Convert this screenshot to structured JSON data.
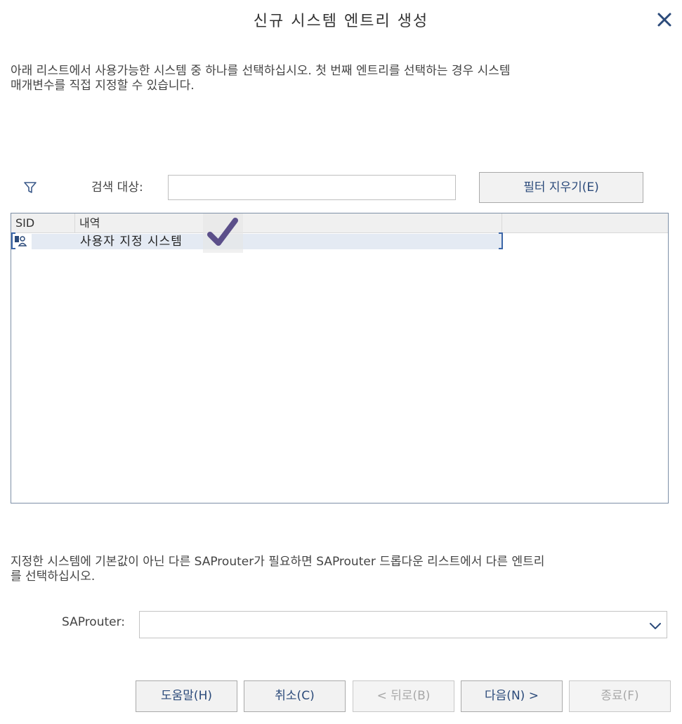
{
  "dialog": {
    "title": "신규 시스템 엔트리 생성",
    "close_icon": "close-icon"
  },
  "intro_text": {
    "line1": "아래 리스트에서 사용가능한 시스템 중 하나를 선택하십시오. 첫 번째 엔트리를 선택하는 경우 시스템",
    "line2": "매개변수를 직접 지정할 수 있습니다."
  },
  "filter": {
    "icon": "filter-icon",
    "search_label": "검색 대상:",
    "search_value": "",
    "clear_button": "필터 지우기(E)"
  },
  "system_list": {
    "columns": [
      "SID",
      "내역",
      ""
    ],
    "rows": [
      {
        "sid_icon": "custom-system-icon",
        "description": "사용자 지정 시스템",
        "selected": true
      }
    ]
  },
  "router_text": {
    "line1": "지정한 시스템에 기본값이 아닌 다른 SAProuter가 필요하면 SAProuter 드롭다운 리스트에서 다른 엔트리",
    "line2": "를 선택하십시오."
  },
  "saprouter": {
    "label": "SAProuter:",
    "selected_value": ""
  },
  "footer": {
    "help": "도움말(H)",
    "cancel": "취소(C)",
    "back": "< 뒤로(B)",
    "next": "다음(N) >",
    "finish": "종료(F)"
  },
  "colors": {
    "accent": "#2b4a7a",
    "selection": "#e4eaf3",
    "checkmark": "#5b4f8a"
  }
}
